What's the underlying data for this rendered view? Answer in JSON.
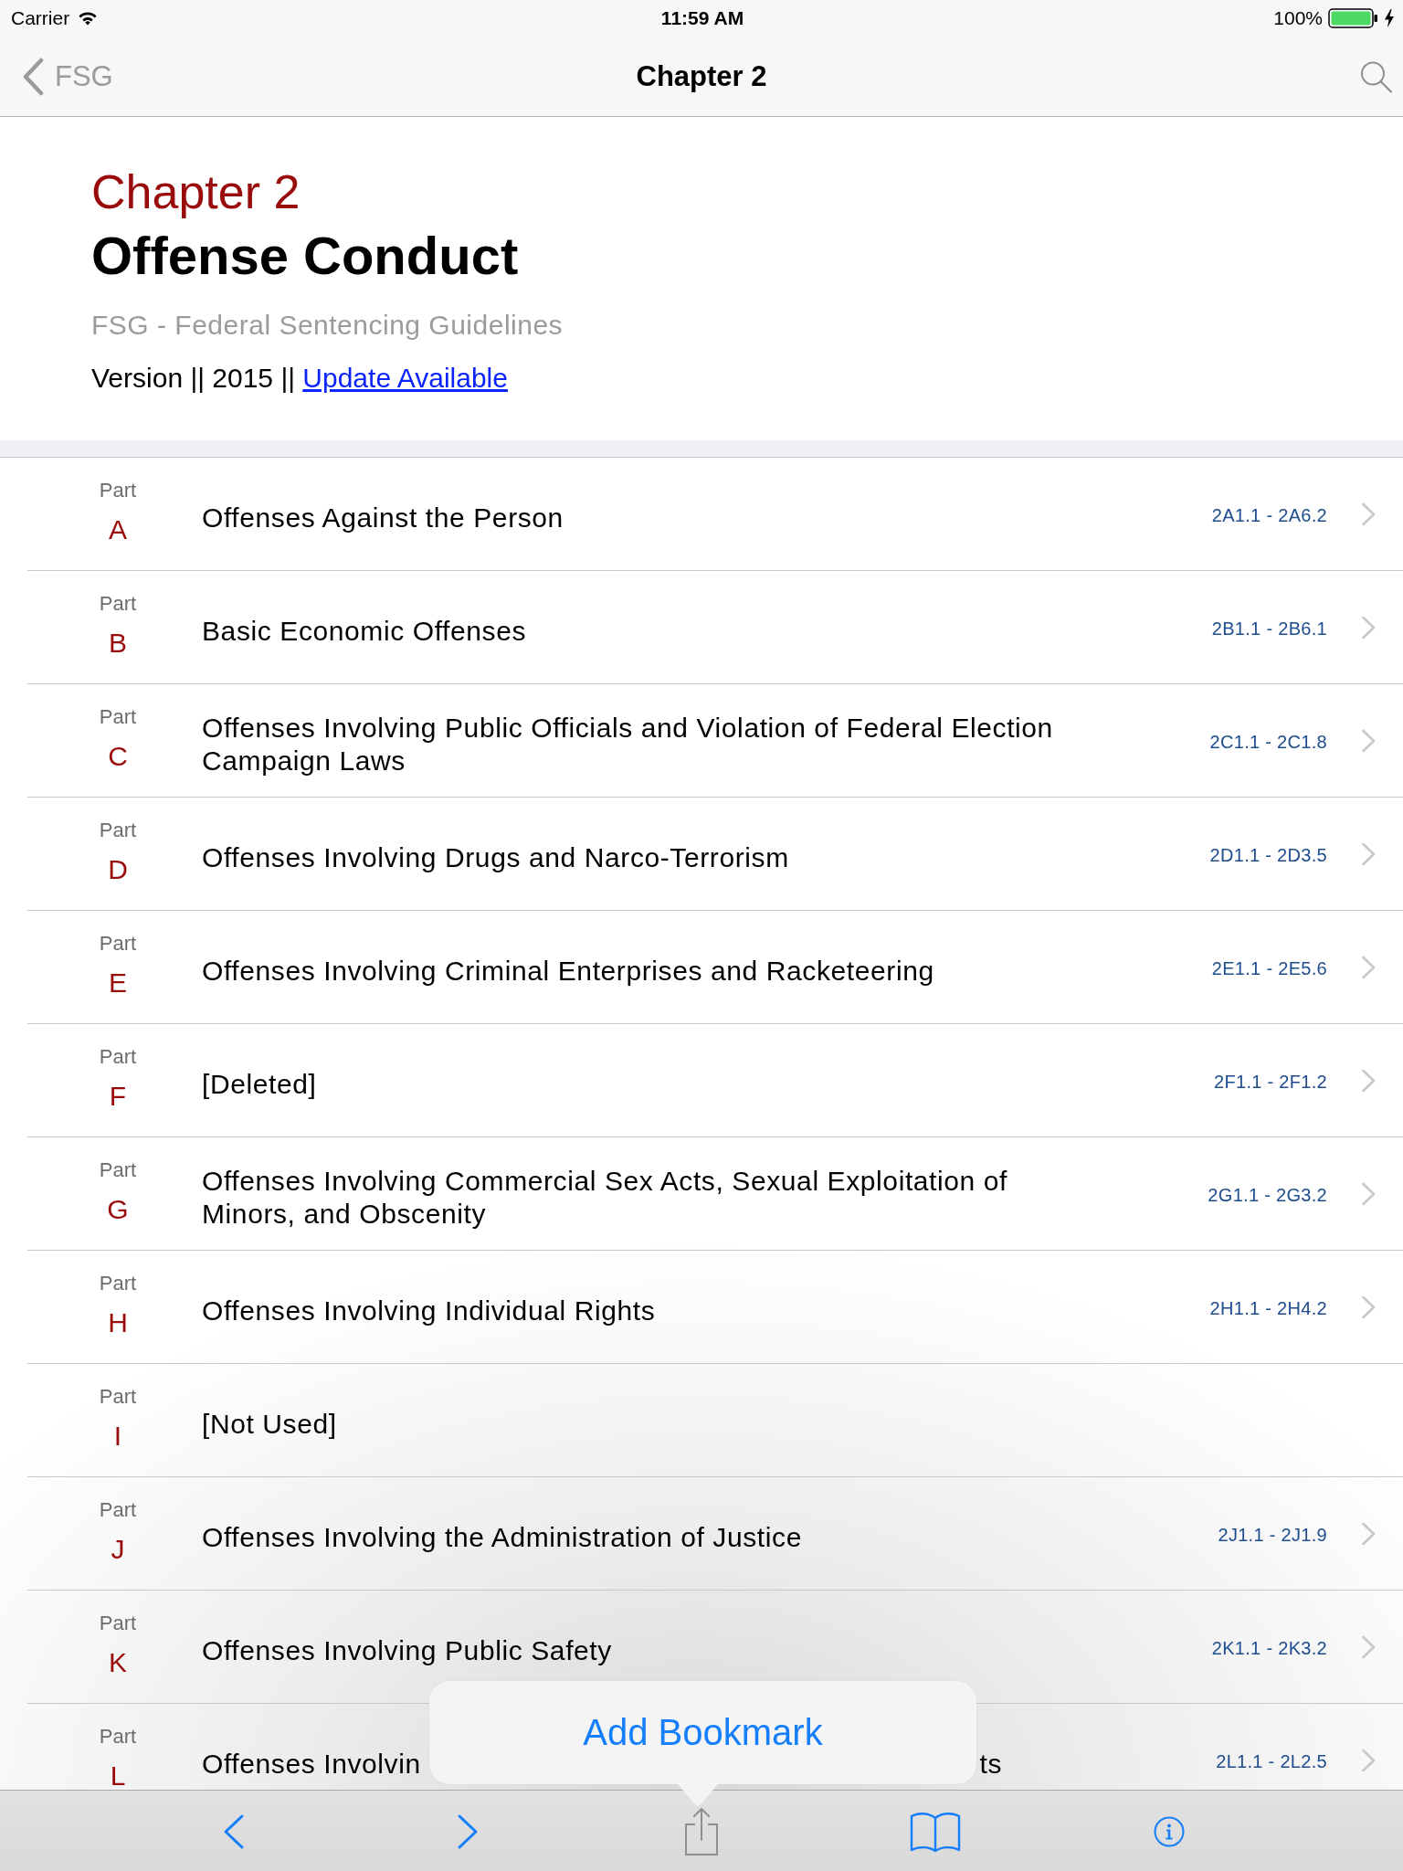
{
  "status_bar": {
    "carrier": "Carrier",
    "time": "11:59 AM",
    "battery": "100%"
  },
  "nav_bar": {
    "back_label": "FSG",
    "title": "Chapter 2"
  },
  "header": {
    "chapter": "Chapter 2",
    "title": "Offense Conduct",
    "subtitle": "FSG - Federal Sentencing Guidelines",
    "version": "Version || 2015 ||",
    "link": "Update Available"
  },
  "parts": [
    {
      "kind": "full",
      "label": "Part",
      "letter": "A",
      "title": "Offenses Against the Person",
      "range": "2A1.1 - 2A6.2",
      "disclosure": true
    },
    {
      "kind": "full",
      "label": "Part",
      "letter": "B",
      "title": "Basic Economic Offenses",
      "range": "2B1.1 - 2B6.1",
      "disclosure": true
    },
    {
      "kind": "full",
      "label": "Part",
      "letter": "C",
      "title": "Offenses Involving Public Officials and Violation of Federal Election Campaign Laws",
      "range": "2C1.1 - 2C1.8",
      "disclosure": true
    },
    {
      "kind": "full",
      "label": "Part",
      "letter": "D",
      "title": "Offenses Involving Drugs and Narco-Terrorism",
      "range": "2D1.1 - 2D3.5",
      "disclosure": true
    },
    {
      "kind": "full",
      "label": "Part",
      "letter": "E",
      "title": "Offenses Involving Criminal Enterprises and Racketeering",
      "range": "2E1.1 - 2E5.6",
      "disclosure": true
    },
    {
      "kind": "full",
      "label": "Part",
      "letter": "F",
      "title": "[Deleted]",
      "range": "2F1.1 - 2F1.2",
      "disclosure": true
    },
    {
      "kind": "full",
      "label": "Part",
      "letter": "G",
      "title": "Offenses Involving Commercial Sex Acts, Sexual Exploitation of Minors, and Obscenity",
      "range": "2G1.1 - 2G3.2",
      "disclosure": true
    },
    {
      "kind": "full",
      "label": "Part",
      "letter": "H",
      "title": "Offenses Involving Individual Rights",
      "range": "2H1.1 - 2H4.2",
      "disclosure": true
    },
    {
      "kind": "full",
      "label": "Part",
      "letter": "I",
      "title": "[Not Used]",
      "disclosure": false
    },
    {
      "kind": "full",
      "label": "Part",
      "letter": "J",
      "title": "Offenses Involving the Administration of Justice",
      "range": "2J1.1 - 2J1.9",
      "disclosure": true
    },
    {
      "kind": "full",
      "label": "Part",
      "letter": "K",
      "title": "Offenses Involving Public Safety",
      "range": "2K1.1 - 2K3.2",
      "disclosure": true
    },
    {
      "kind": "covered",
      "label": "Part",
      "letter": "L",
      "title_start": "Offenses Involvin",
      "title_end": "ts",
      "range": "2L1.1 - 2L2.5",
      "disclosure": true
    }
  ],
  "popover": {
    "action": "Add Bookmark"
  },
  "toolbar": [
    {
      "kind": "back",
      "disabled": false
    },
    {
      "kind": "forward",
      "disabled": false
    },
    {
      "kind": "share",
      "disabled": true
    },
    {
      "kind": "bookmarks",
      "disabled": false
    },
    {
      "kind": "info",
      "disabled": false
    }
  ]
}
